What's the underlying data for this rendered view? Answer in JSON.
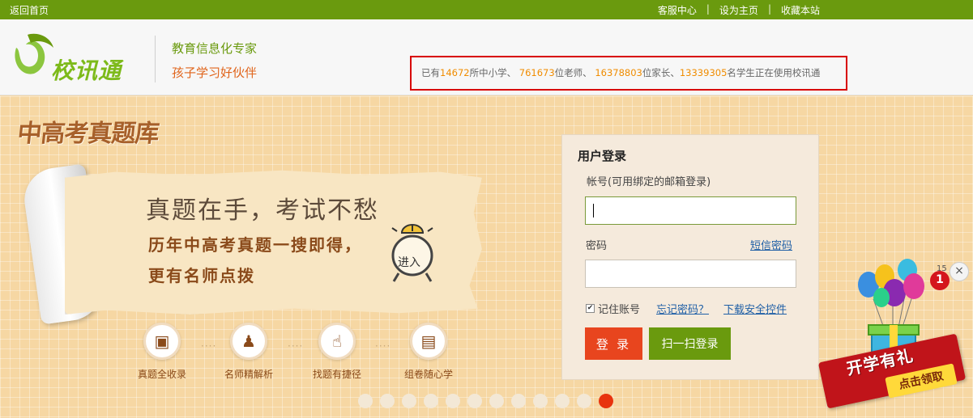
{
  "topbar": {
    "home_link": "返回首页",
    "links": [
      "客服中心",
      "设为主页",
      "收藏本站"
    ],
    "separator": "|"
  },
  "header": {
    "logo_text": "校讯通",
    "slogan_1": "教育信息化专家",
    "slogan_2": "孩子学习好伙伴",
    "stats": {
      "prefix": "已有",
      "schools": "14672",
      "schools_suffix": "所中小学、",
      "teachers": "761673",
      "teachers_suffix": "位老师、",
      "parents": "16378803",
      "parents_suffix": "位家长、",
      "students": "13339305",
      "students_suffix": "名学生正在使用校讯通"
    }
  },
  "banner": {
    "title": "中高考真题库",
    "headline": "真题在手，考试不愁",
    "line_2": "历年中高考真题一搜即得，",
    "line_3": "更有名师点拨",
    "enter_label": "进入",
    "features": [
      {
        "label": "真题全收录",
        "icon": "monitor-icon"
      },
      {
        "label": "名师精解析",
        "icon": "teacher-icon"
      },
      {
        "label": "找题有捷径",
        "icon": "thumbs-up-icon"
      },
      {
        "label": "组卷随心学",
        "icon": "document-icon"
      }
    ],
    "pager": {
      "total": 12,
      "active_index": 11
    }
  },
  "login": {
    "title": "用户登录",
    "account_label": "帐号(可用绑定的邮箱登录)",
    "account_value": "",
    "password_label": "密码",
    "sms_password_link": "短信密码",
    "password_value": "",
    "remember_label": "记住账号",
    "remember_checked": true,
    "forgot_link": "忘记密码？",
    "download_link": "下载安全控件",
    "login_button": "登 录",
    "scan_button": "扫一扫登录"
  },
  "promo": {
    "badge_count": "1",
    "timer": "15",
    "title": "开学有礼",
    "cta": "点击领取",
    "close": "×"
  },
  "colors": {
    "green": "#6a9a0e",
    "orange_number": "#f08c00",
    "red_button": "#e8451e",
    "link_blue": "#1f5fa6"
  }
}
